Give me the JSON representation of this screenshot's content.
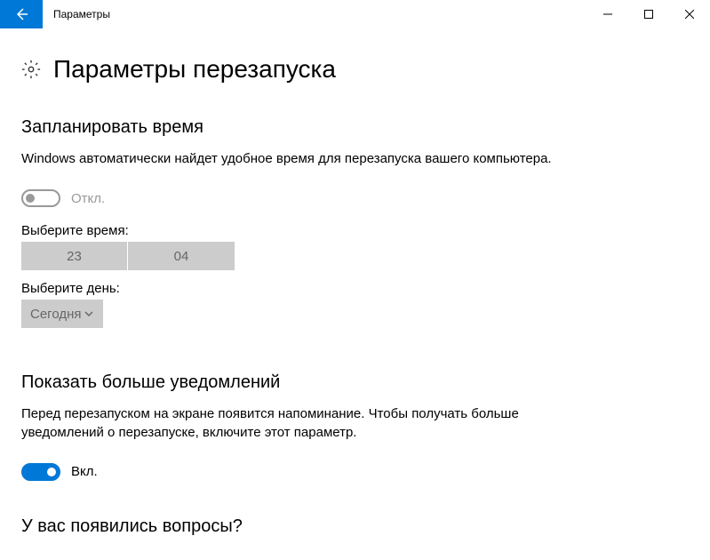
{
  "window": {
    "title": "Параметры"
  },
  "page": {
    "title": "Параметры перезапуска"
  },
  "schedule": {
    "heading": "Запланировать время",
    "description": "Windows автоматически найдет удобное время для перезапуска вашего компьютера.",
    "toggle_label": "Откл.",
    "time_label": "Выберите время:",
    "time_hour": "23",
    "time_minute": "04",
    "day_label": "Выберите день:",
    "day_value": "Сегодня"
  },
  "notifications": {
    "heading": "Показать больше уведомлений",
    "description": "Перед перезапуском на экране появится напоминание. Чтобы получать больше уведомлений о перезапуске, включите этот параметр.",
    "toggle_label": "Вкл."
  },
  "questions": {
    "heading": "У вас появились вопросы?"
  }
}
